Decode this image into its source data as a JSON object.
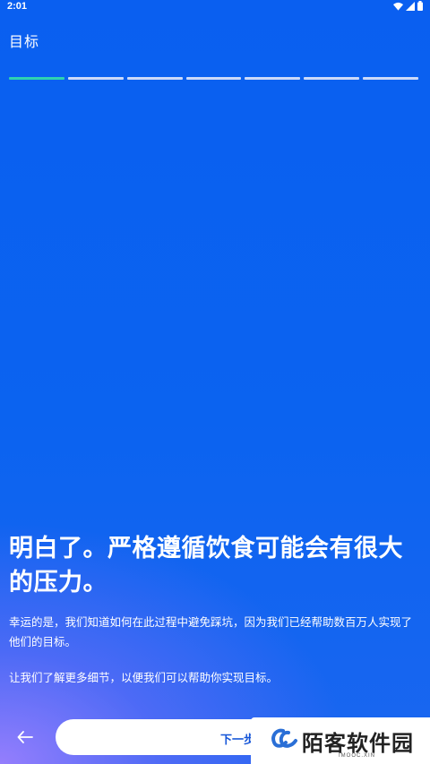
{
  "status_bar": {
    "time": "2:01",
    "icons": [
      "wifi-icon",
      "signal-icon",
      "battery-icon"
    ]
  },
  "header": {
    "title": "目标"
  },
  "progress": {
    "total_steps": 7,
    "current_step": 1,
    "active_color": "#2ed3b0"
  },
  "content": {
    "heading": "明白了。严格遵循饮食可能会有很大的压力。",
    "paragraph_1": "幸运的是，我们知道如何在此过程中避免踩坑，因为我们已经帮助数百万人实现了他们的目标。",
    "paragraph_2": "让我们了解更多细节，以便我们可以帮助你实现目标。"
  },
  "footer": {
    "back_icon": "arrow-left-icon",
    "next_label": "下一步"
  },
  "watermark": {
    "text": "陌客软件园",
    "subtext": "IMOOC.XIN"
  },
  "colors": {
    "background": "#0a62ee",
    "button_text": "#1656d8"
  }
}
